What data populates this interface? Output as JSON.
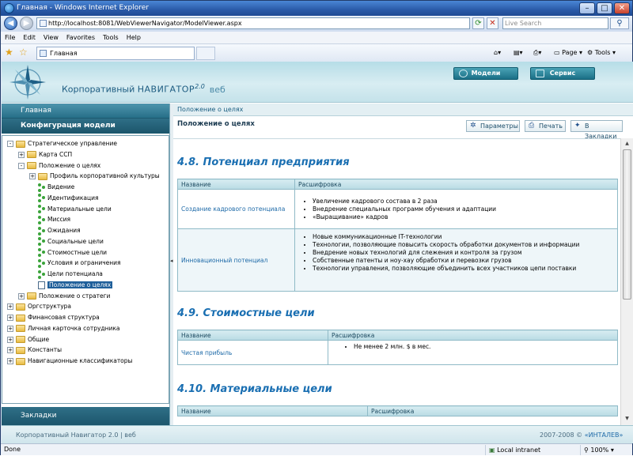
{
  "window": {
    "title": "Главная - Windows Internet Explorer"
  },
  "address": {
    "url": "http://localhost:8081/WebViewerNavigator/ModelViewer.aspx",
    "search_placeholder": "Live Search"
  },
  "menu": [
    "File",
    "Edit",
    "View",
    "Favorites",
    "Tools",
    "Help"
  ],
  "tab": {
    "label": "Главная"
  },
  "commands": {
    "page": "Page",
    "tools": "Tools"
  },
  "app": {
    "brand": "Корпоративный",
    "brand_name": "НАВИГАТОР",
    "version": "2.0",
    "suffix": "веб",
    "top_buttons": [
      "Модели",
      "Сервис"
    ]
  },
  "sidebar": {
    "header": "Главная",
    "section": "Конфигурация модели",
    "footer": "Закладки",
    "tree": [
      {
        "label": "Стратегическое управление",
        "kind": "folder",
        "level": 0,
        "exp": "-"
      },
      {
        "label": "Карта ССП",
        "kind": "folder",
        "level": 1,
        "exp": "+"
      },
      {
        "label": "Положение о целях",
        "kind": "folder",
        "level": 1,
        "exp": "-"
      },
      {
        "label": "Профиль корпоративной культуры",
        "kind": "folder",
        "level": 2,
        "exp": "+"
      },
      {
        "label": "Видение",
        "kind": "leaf",
        "level": 2
      },
      {
        "label": "Идентификация",
        "kind": "leaf",
        "level": 2
      },
      {
        "label": "Материальные цели",
        "kind": "leaf",
        "level": 2
      },
      {
        "label": "Миссия",
        "kind": "leaf",
        "level": 2
      },
      {
        "label": "Ожидания",
        "kind": "leaf",
        "level": 2
      },
      {
        "label": "Социальные цели",
        "kind": "leaf",
        "level": 2
      },
      {
        "label": "Стоимостные цели",
        "kind": "leaf",
        "level": 2
      },
      {
        "label": "Условия и ограничения",
        "kind": "leaf",
        "level": 2
      },
      {
        "label": "Цели потенциала",
        "kind": "leaf",
        "level": 2
      },
      {
        "label": "Положение о целях",
        "kind": "doc",
        "level": 2,
        "selected": true
      },
      {
        "label": "Положение о стратеги",
        "kind": "folder",
        "level": 1,
        "exp": "+"
      },
      {
        "label": "Оргструктура",
        "kind": "folder",
        "level": 0,
        "exp": "+"
      },
      {
        "label": "Финансовая структура",
        "kind": "folder",
        "level": 0,
        "exp": "+"
      },
      {
        "label": "Личная карточка сотрудника",
        "kind": "folder",
        "level": 0,
        "exp": "+"
      },
      {
        "label": "Общие",
        "kind": "folder",
        "level": 0,
        "exp": "+"
      },
      {
        "label": "Константы",
        "kind": "folder",
        "level": 0,
        "exp": "+"
      },
      {
        "label": "Навигационные классификаторы",
        "kind": "folder",
        "level": 0,
        "exp": "+"
      }
    ]
  },
  "content": {
    "breadcrumb": "Положение о целях",
    "title": "Положение о целях",
    "actions": [
      "Параметры",
      "Печать",
      "В Закладки"
    ],
    "col_name": "Название",
    "col_desc": "Расшифровка",
    "sections": [
      {
        "heading": "4.8. Потенциал предприятия",
        "rows": [
          {
            "name": "Создание кадрового потенциала",
            "items": [
              "Увеличение кадрового состава в 2 раза",
              "Внедрение специальных программ обучения и адаптации",
              "«Выращивание» кадров"
            ]
          },
          {
            "name": "Инновационный потенциал",
            "items": [
              "Новые коммуникационные IT-технологии",
              "Технологии, позволяющие повысить скорость обработки документов и информации",
              "Внедрение новых технологий для слежения и контроля за грузом",
              "Собственные патенты и ноу-хау обработки и перевозки грузов",
              "Технологии управления, позволяющие объединить всех участников цепи поставки"
            ]
          }
        ]
      },
      {
        "heading": "4.9. Стоимостные цели",
        "rows": [
          {
            "name": "Чистая прибыль",
            "items": [
              "Не менее 2 млн. $ в мес."
            ]
          }
        ]
      },
      {
        "heading": "4.10. Материальные цели",
        "rows": []
      }
    ]
  },
  "footer": {
    "left": "Корпоративный Навигатор 2.0 | веб",
    "right_prefix": "2007-2008 © ",
    "right_link": "«ИНТАЛЕВ»"
  },
  "status": {
    "left": "Done",
    "zone": "Local intranet",
    "zoom": "100%"
  }
}
